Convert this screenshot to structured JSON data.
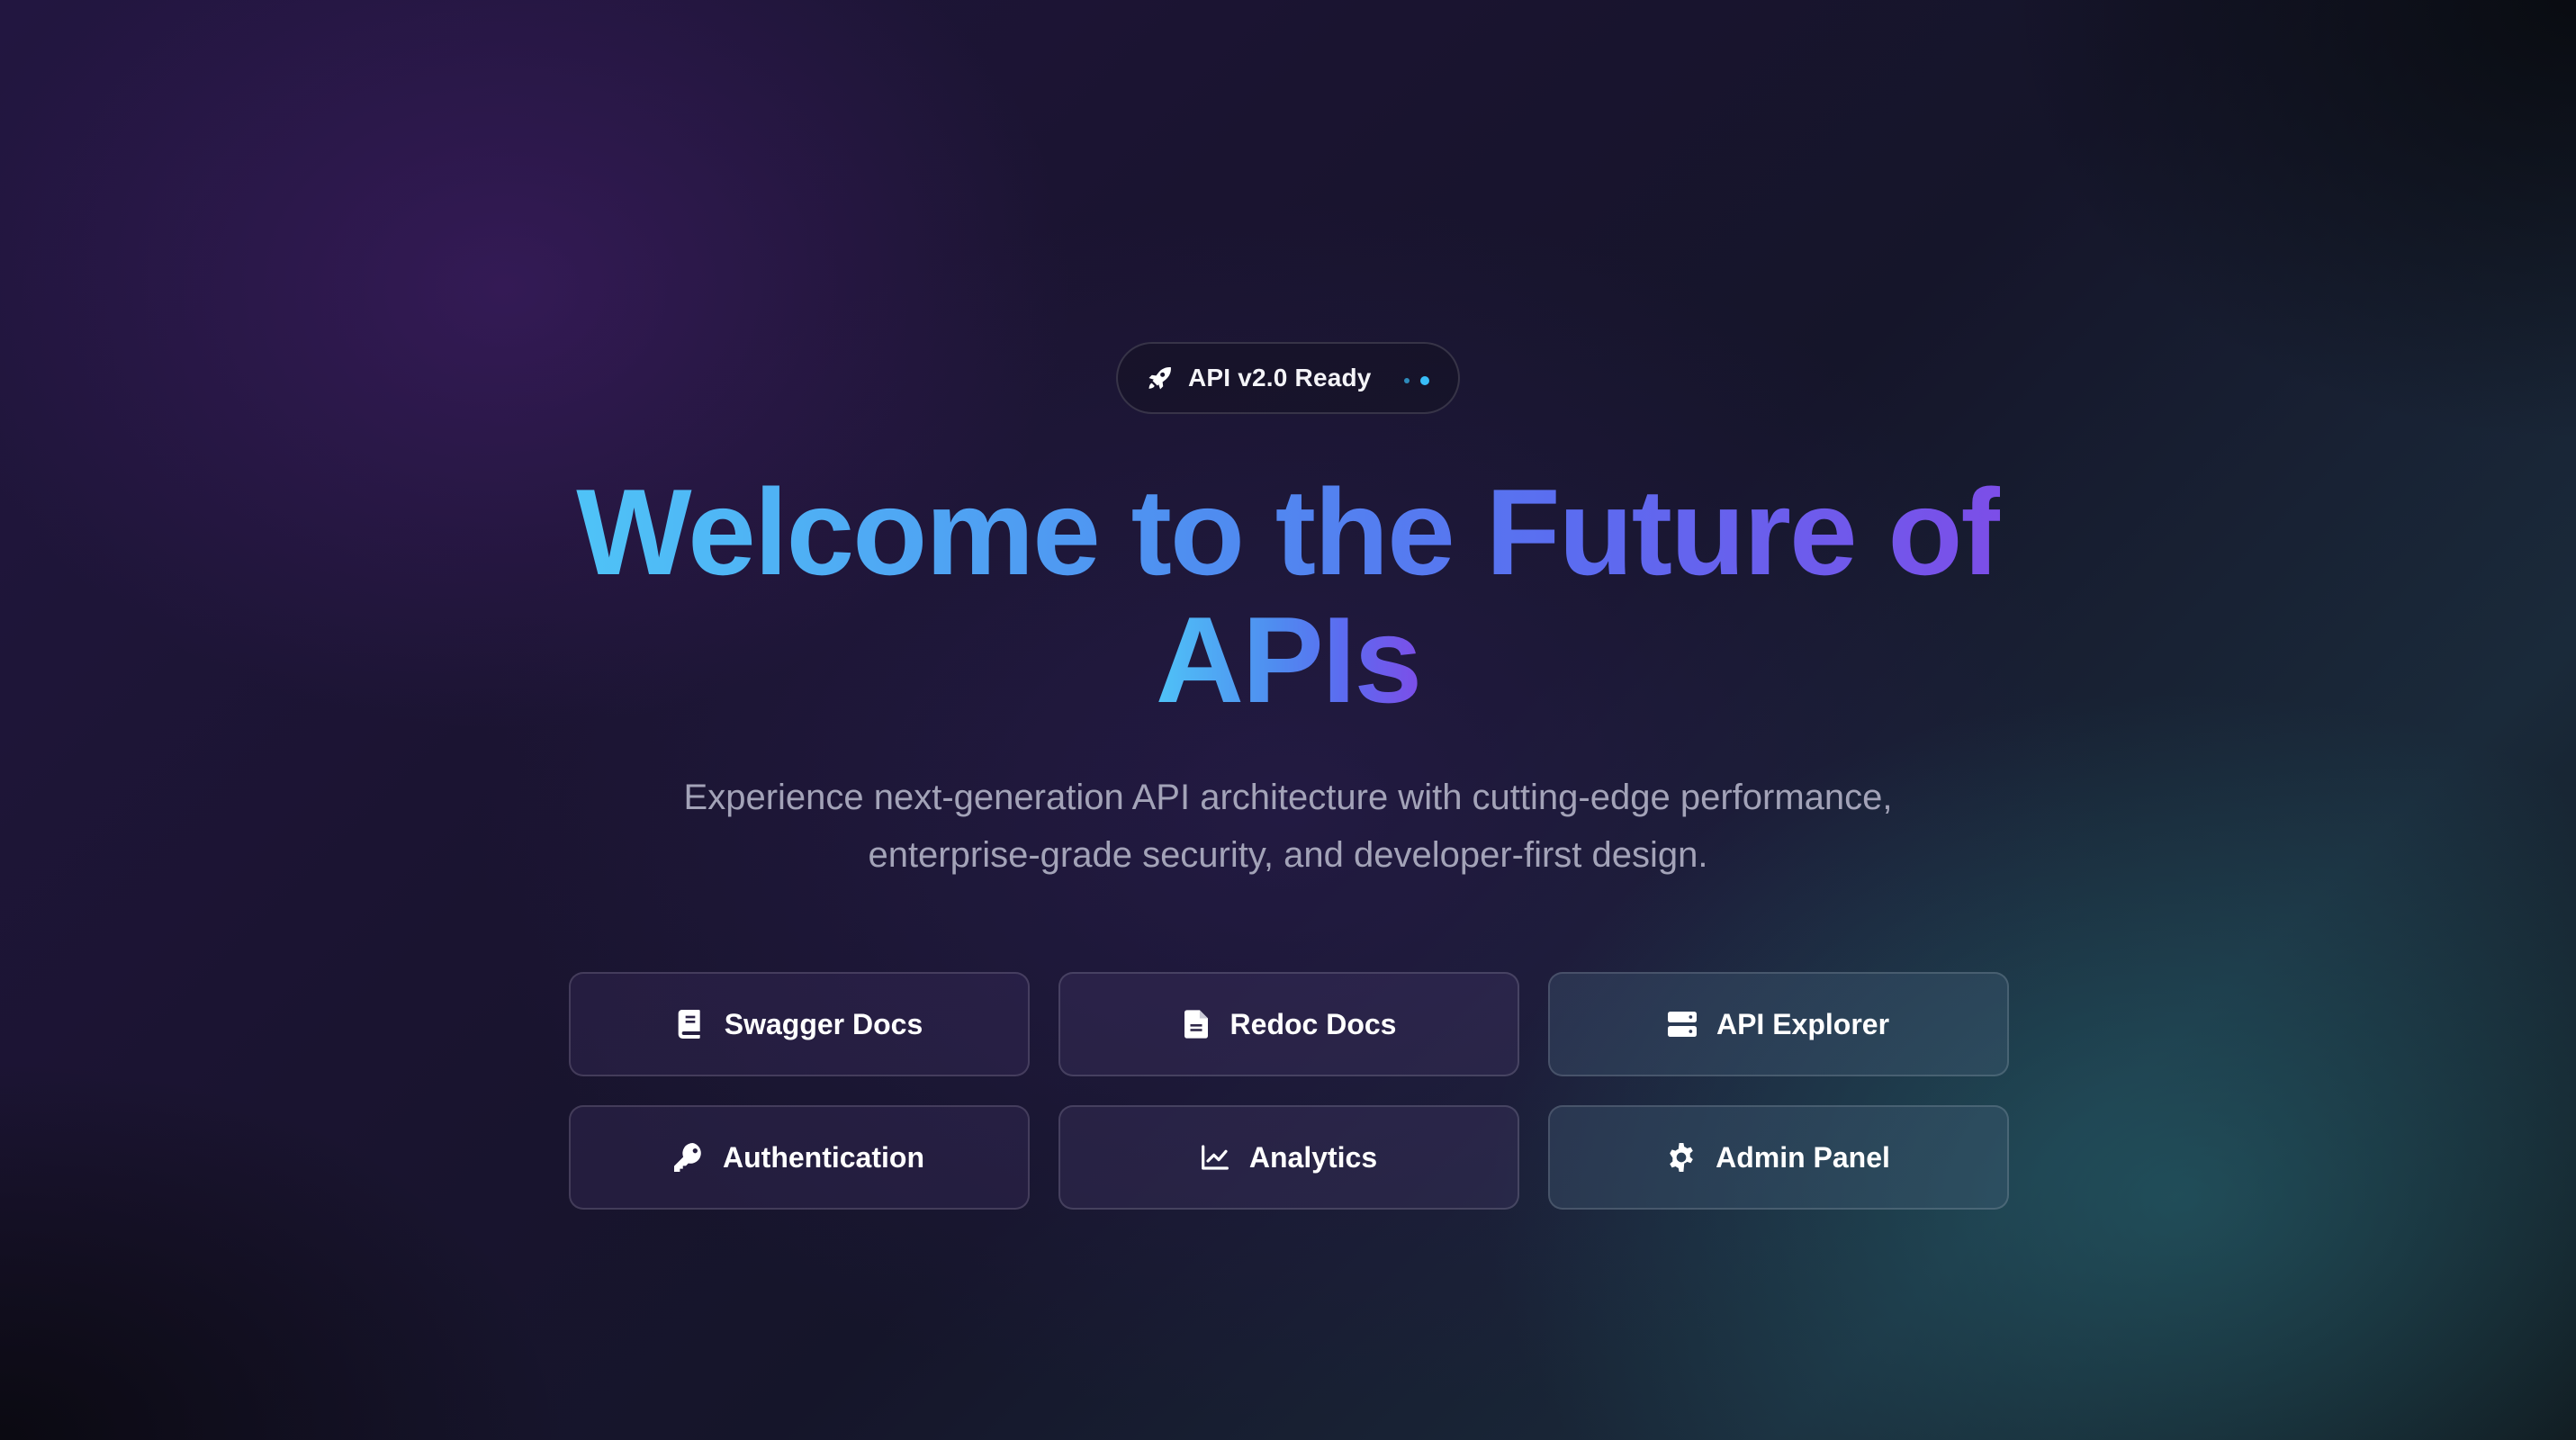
{
  "badge": {
    "label": "API v2.0 Ready",
    "icon": "rocket-icon",
    "dot_color": "#38bdf8"
  },
  "hero": {
    "title_line1": "Welcome to the Future of",
    "title_line2": "APIs",
    "subtitle_line1": "Experience next-generation API architecture with cutting-edge performance,",
    "subtitle_line2": "enterprise-grade security, and developer-first design.",
    "gradient_colors": [
      "#4fc3f7",
      "#4f8cf0",
      "#5b6cf0",
      "#7c4ee8"
    ]
  },
  "links": [
    {
      "label": "Swagger Docs",
      "icon": "book-icon"
    },
    {
      "label": "Redoc Docs",
      "icon": "document-icon"
    },
    {
      "label": "API Explorer",
      "icon": "server-icon"
    },
    {
      "label": "Authentication",
      "icon": "key-icon"
    },
    {
      "label": "Analytics",
      "icon": "chart-line-icon"
    },
    {
      "label": "Admin Panel",
      "icon": "gear-icon"
    }
  ]
}
